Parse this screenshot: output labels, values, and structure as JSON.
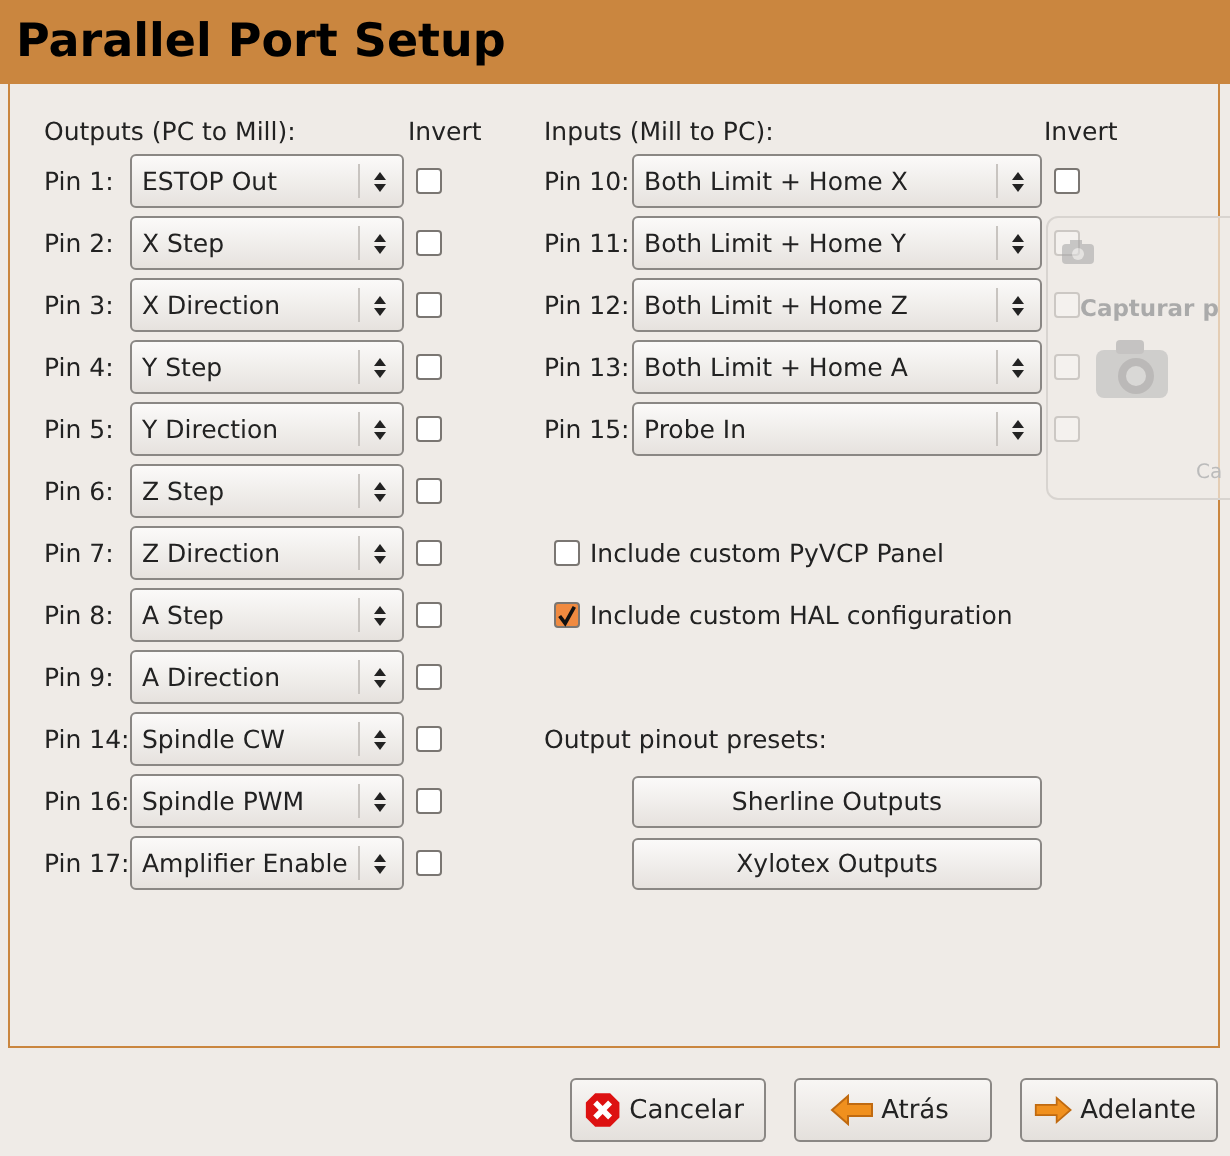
{
  "window": {
    "title": "Parallel Port Setup"
  },
  "outputs": {
    "heading": "Outputs (PC to Mill):",
    "invert_heading": "Invert",
    "pins": [
      {
        "label": "Pin 1:",
        "value": "ESTOP Out",
        "inverted": false
      },
      {
        "label": "Pin 2:",
        "value": "X Step",
        "inverted": false
      },
      {
        "label": "Pin 3:",
        "value": "X Direction",
        "inverted": false
      },
      {
        "label": "Pin 4:",
        "value": "Y Step",
        "inverted": false
      },
      {
        "label": "Pin 5:",
        "value": "Y Direction",
        "inverted": false
      },
      {
        "label": "Pin 6:",
        "value": "Z Step",
        "inverted": false
      },
      {
        "label": "Pin 7:",
        "value": "Z Direction",
        "inverted": false
      },
      {
        "label": "Pin 8:",
        "value": "A Step",
        "inverted": false
      },
      {
        "label": "Pin 9:",
        "value": "A Direction",
        "inverted": false
      },
      {
        "label": "Pin 14:",
        "value": "Spindle CW",
        "inverted": false
      },
      {
        "label": "Pin 16:",
        "value": "Spindle PWM",
        "inverted": false
      },
      {
        "label": "Pin 17:",
        "value": "Amplifier Enable",
        "inverted": false
      }
    ]
  },
  "inputs": {
    "heading": "Inputs (Mill to PC):",
    "invert_heading": "Invert",
    "pins": [
      {
        "label": "Pin 10:",
        "value": "Both Limit + Home X",
        "inverted": false
      },
      {
        "label": "Pin 11:",
        "value": "Both Limit + Home Y",
        "inverted": false
      },
      {
        "label": "Pin 12:",
        "value": "Both Limit + Home Z",
        "inverted": false
      },
      {
        "label": "Pin 13:",
        "value": "Both Limit + Home A",
        "inverted": false
      },
      {
        "label": "Pin 15:",
        "value": "Probe In",
        "inverted": false
      }
    ]
  },
  "options": [
    {
      "label": "Include custom PyVCP Panel",
      "checked": false
    },
    {
      "label": "Include custom HAL configuration",
      "checked": true
    }
  ],
  "presets": {
    "heading": "Output pinout presets:",
    "buttons": [
      "Sherline Outputs",
      "Xylotex Outputs"
    ]
  },
  "overlay_window": {
    "title": "Capturar p",
    "text": "Ca"
  },
  "buttons": [
    {
      "label": "Cancelar",
      "kind": "cancel"
    },
    {
      "label": "Atrás",
      "kind": "back"
    },
    {
      "label": "Adelante",
      "kind": "forward"
    }
  ]
}
